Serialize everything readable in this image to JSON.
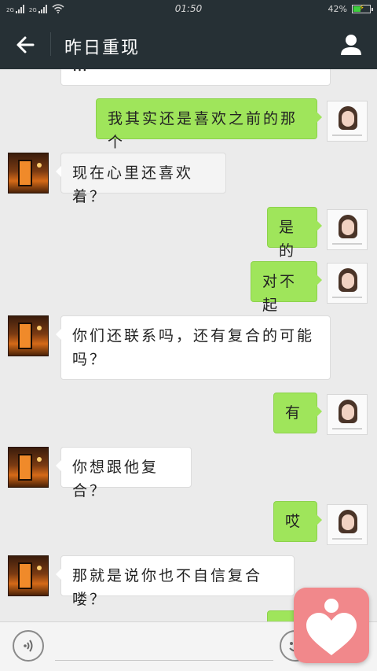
{
  "status_bar": {
    "sim1": "2G",
    "sim2": "2G",
    "time": "01:50",
    "battery": "42%",
    "battery_level": 0.42
  },
  "header": {
    "title": "昨日重现",
    "back_icon": "arrow-left-icon",
    "profile_icon": "person-icon"
  },
  "messages": [
    {
      "side": "in",
      "text": "…"
    },
    {
      "side": "out",
      "text": "我其实还是喜欢之前的那个"
    },
    {
      "side": "in",
      "text": "现在心里还喜欢着？"
    },
    {
      "side": "out",
      "text": "是的"
    },
    {
      "side": "out",
      "text": "对不起"
    },
    {
      "side": "in",
      "text": "你们还联系吗，还有复合的可能吗？"
    },
    {
      "side": "out",
      "text": "有"
    },
    {
      "side": "in",
      "text": "你想跟他复合？"
    },
    {
      "side": "out",
      "text": "哎"
    },
    {
      "side": "in",
      "text": "那就是说你也不自信复合喽？"
    }
  ],
  "input_bar": {
    "voice_icon": "voice-icon",
    "emoji_icon": "emoji-icon"
  },
  "floating_widget": {
    "icon": "heart-person-icon",
    "color": "#f1888b"
  },
  "colors": {
    "header_bg": "#263035",
    "bubble_out": "#9fe55b",
    "bubble_in": "#ffffff",
    "chat_bg": "#ebebeb"
  }
}
